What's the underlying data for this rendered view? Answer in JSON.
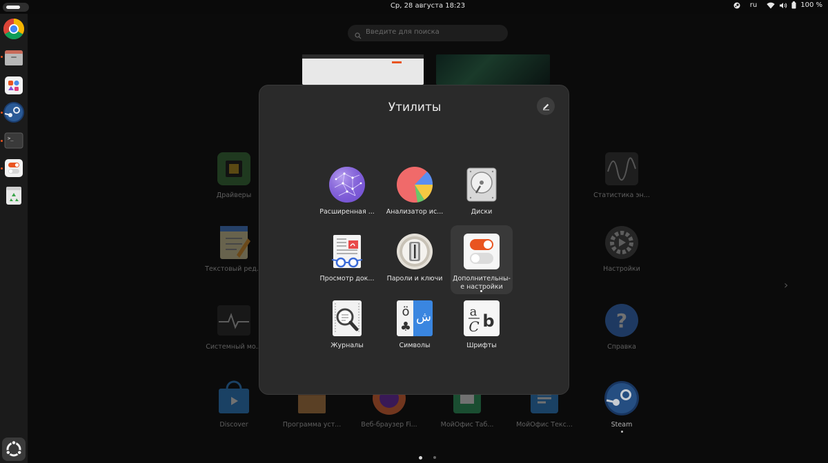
{
  "topbar": {
    "clock": "Ср, 28 августа  18:23",
    "lang": "ru",
    "battery": "100 %"
  },
  "dock": {
    "items": [
      {
        "name": "chrome-icon"
      },
      {
        "name": "files-icon"
      },
      {
        "name": "software-icon"
      },
      {
        "name": "steam-icon"
      },
      {
        "name": "terminal-icon"
      },
      {
        "name": "tweaks-icon"
      },
      {
        "name": "trash-icon"
      }
    ]
  },
  "search": {
    "placeholder": "Введите для поиска"
  },
  "background_apps": [
    {
      "label": "Драйверы",
      "icon": "chip-icon"
    },
    {
      "label": "Статистика эн...",
      "icon": "power-stats-icon"
    },
    {
      "label": "Текстовый ред...",
      "icon": "text-editor-icon"
    },
    {
      "label": "Настройки",
      "icon": "settings-icon"
    },
    {
      "label": "Системный мо...",
      "icon": "system-monitor-icon"
    },
    {
      "label": "Справка",
      "icon": "help-icon"
    },
    {
      "label": "Discover",
      "icon": "discover-icon"
    },
    {
      "label": "Программа уст...",
      "icon": "installer-icon"
    },
    {
      "label": "Веб-браузер Fi...",
      "icon": "firefox-icon"
    },
    {
      "label": "МойОфис Таб...",
      "icon": "myoffice-tables-icon"
    },
    {
      "label": "МойОфис Текс...",
      "icon": "myoffice-text-icon"
    },
    {
      "label": "Steam",
      "icon": "steam-icon"
    }
  ],
  "folder": {
    "title": "Утилиты",
    "apps": [
      {
        "label": "Расширенная ...",
        "icon": "extension-manager-icon"
      },
      {
        "label": "Анализатор ис...",
        "icon": "disk-usage-icon"
      },
      {
        "label": "Диски",
        "icon": "disks-icon"
      },
      {
        "label": "Просмотр док...",
        "icon": "document-viewer-icon"
      },
      {
        "label": "Пароли и ключи",
        "icon": "passwords-keys-icon"
      },
      {
        "label": "Дополнительны-е настройки",
        "icon": "tweaks-icon"
      },
      {
        "label": "Журналы",
        "icon": "logs-icon"
      },
      {
        "label": "Символы",
        "icon": "characters-icon"
      },
      {
        "label": "Шрифты",
        "icon": "fonts-icon"
      }
    ]
  },
  "colors": {
    "accent": "#e95420",
    "folder_bg": "#2a2a2a",
    "dock_bg": "#1b1b1b"
  }
}
